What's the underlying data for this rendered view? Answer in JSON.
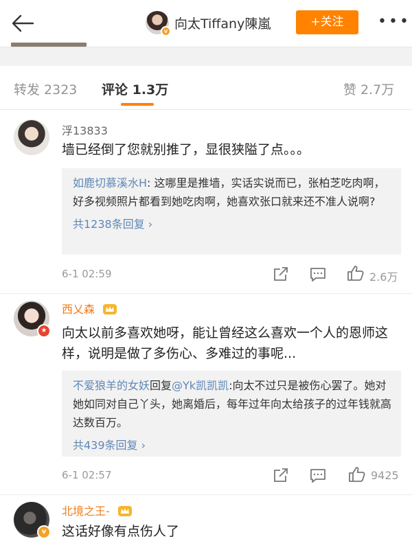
{
  "header": {
    "title": "向太Tiffany陳嵐",
    "follow_label": "+关注",
    "more_label": "•••"
  },
  "tabs": [
    {
      "label": "转发 2323"
    },
    {
      "label": "评论 1.3万"
    },
    {
      "label": "赞 2.7万"
    }
  ],
  "comments": [
    {
      "name": "浮13833",
      "name_color": "#666666",
      "text": "墙已经倒了您就别推了，显很狭隘了点。。。",
      "reply": {
        "user": "如鹿切慕溪水H",
        "text": ": 这哪里是推墙，实话实说而已，张柏芝吃肉啊，好多视频照片都看到她吃肉啊，她喜欢张口就来还不准人说啊?",
        "more": "共1238条回复 ›"
      },
      "time": "6-1 02:59",
      "likes": "2.6万"
    },
    {
      "name": "西乂森",
      "name_color": "#f07c1a",
      "text": "向太以前多喜欢她呀，能让曾经这么喜欢一个人的恩师这样，说明是做了多伤心、多难过的事呢...",
      "reply": {
        "user": "不爱狼羊的女妖",
        "mid": "回复",
        "user2": "@Yk凯凯凯",
        "text": ":向太不过只是被伤心罢了。她对她如同对自己丫头，她离婚后，每年过年向太给孩子的过年钱就高达数百万。",
        "more": "共439条回复 ›"
      },
      "time": "6-1 02:57",
      "likes": "9425"
    },
    {
      "name": "北境之王-",
      "name_color": "#f07c1a",
      "text": "这话好像有点伤人了"
    }
  ],
  "colors": {
    "accent": "#ff8200",
    "link": "#5f87b7",
    "vip_name": "#f07c1a"
  }
}
